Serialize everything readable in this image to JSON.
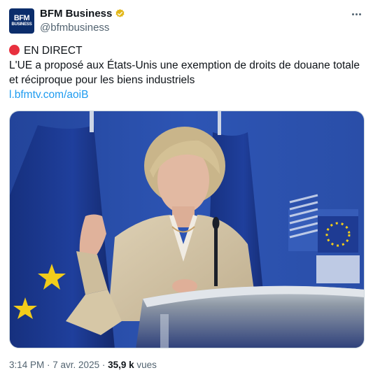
{
  "author": {
    "name": "BFM Business",
    "handle": "@bfmbusiness",
    "avatar_line1": "BFM",
    "avatar_line2": "BUSINESS",
    "verified_color": "#f4b400"
  },
  "tweet": {
    "live_label": "EN DIRECT",
    "line1": "L'UE a proposé aux États-Unis une exemption de droits de douane totale",
    "line2": "et réciproque pour les biens industriels",
    "link": "l.bfmtv.com/aoiB"
  },
  "footer": {
    "time": "3:14 PM",
    "separator1": " · ",
    "date": "7 avr. 2025",
    "separator2": " · ",
    "views_count": "35,9 k",
    "views_label": " vues"
  },
  "colors": {
    "accent": "#1d9bf0",
    "muted": "#536471",
    "live_dot": "#e8303e"
  },
  "icons": [
    "verified-badge-icon",
    "more-options-icon",
    "live-dot-icon"
  ]
}
